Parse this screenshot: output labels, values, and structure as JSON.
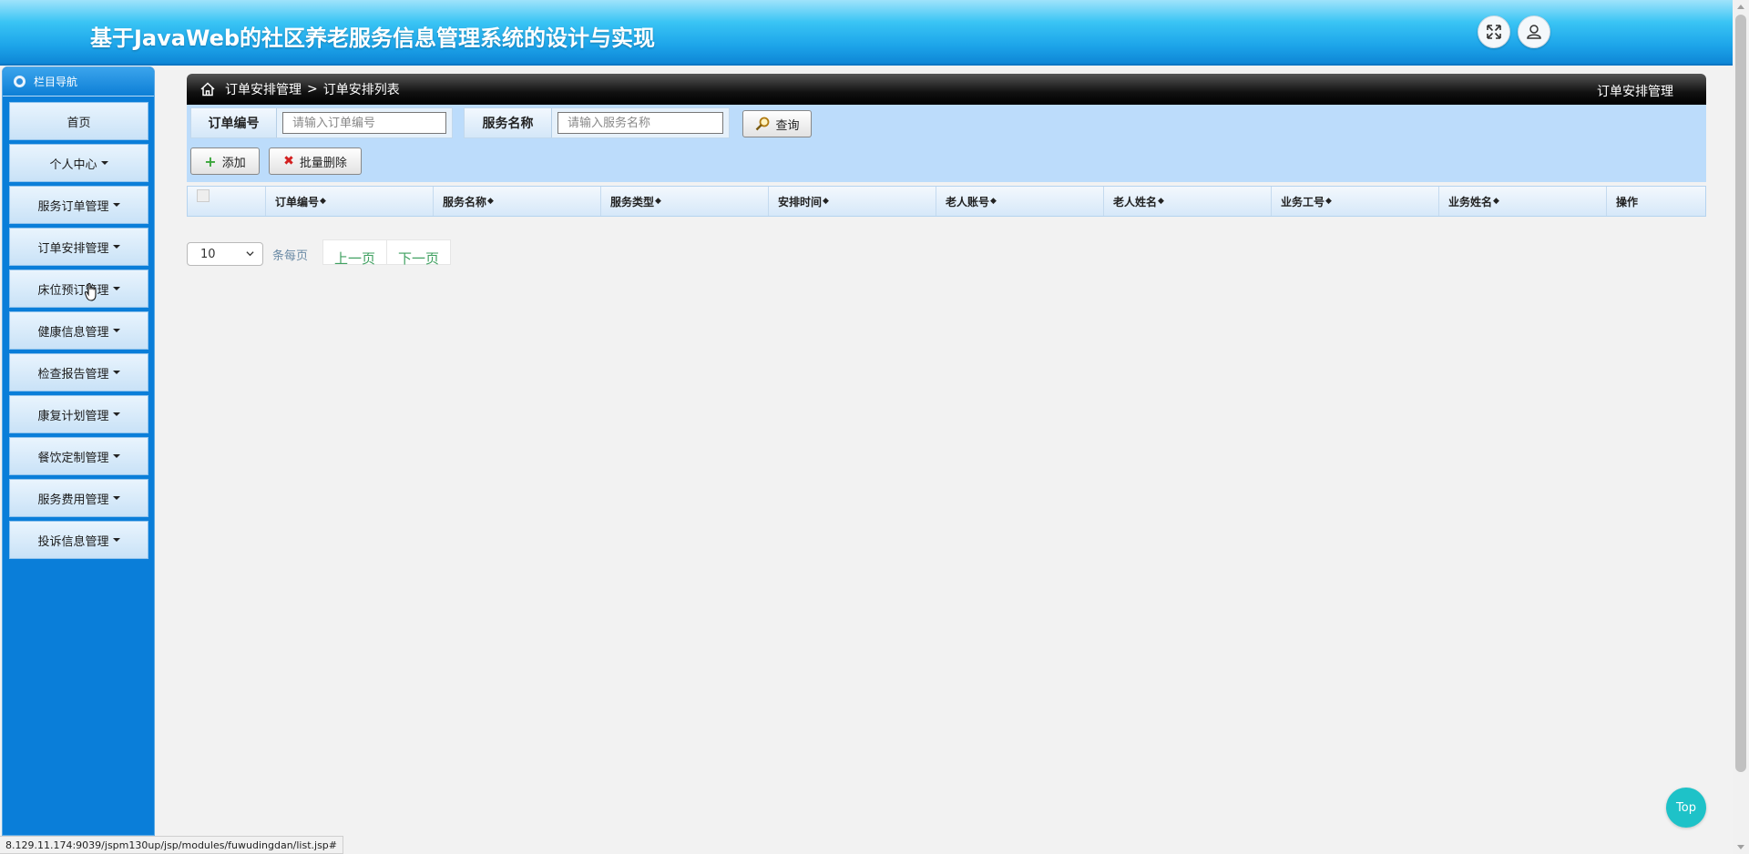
{
  "header": {
    "title": "基于JavaWeb的社区养老服务信息管理系统的设计与实现",
    "fullscreen_icon": "expand-icon",
    "user_icon": "user-icon"
  },
  "sidebar": {
    "heading": "栏目导航",
    "items": [
      {
        "label": "首页",
        "has_caret": false
      },
      {
        "label": "个人中心",
        "has_caret": true
      },
      {
        "label": "服务订单管理",
        "has_caret": true
      },
      {
        "label": "订单安排管理",
        "has_caret": true
      },
      {
        "label": "床位预订管理",
        "has_caret": true
      },
      {
        "label": "健康信息管理",
        "has_caret": true
      },
      {
        "label": "检查报告管理",
        "has_caret": true
      },
      {
        "label": "康复计划管理",
        "has_caret": true
      },
      {
        "label": "餐饮定制管理",
        "has_caret": true
      },
      {
        "label": "服务费用管理",
        "has_caret": true
      },
      {
        "label": "投诉信息管理",
        "has_caret": true
      }
    ]
  },
  "breadcrumb": {
    "parent": "订单安排管理",
    "separator": ">",
    "current": "订单安排列表",
    "right_title": "订单安排管理"
  },
  "search": {
    "order_no_label": "订单编号",
    "order_no_placeholder": "请输入订单编号",
    "order_no_value": "",
    "service_name_label": "服务名称",
    "service_name_placeholder": "请输入服务名称",
    "service_name_value": "",
    "query_button": "查询",
    "add_button": "添加",
    "batch_delete_button": "批量删除"
  },
  "table": {
    "columns": [
      "订单编号",
      "服务名称",
      "服务类型",
      "安排时间",
      "老人账号",
      "老人姓名",
      "业务工号",
      "业务姓名",
      "操作"
    ],
    "rows": []
  },
  "pagination": {
    "page_size": "10",
    "per_page_label": "条每页",
    "prev": "上一页",
    "next": "下一页"
  },
  "top_button": "Top",
  "status_url": "8.129.11.174:9039/jspm130up/jsp/modules/fuwudingdan/list.jsp#",
  "colors": {
    "sidebar_bg": "#0a7ed9",
    "search_bg": "#bcdcfb",
    "top_button": "#1ec2c8"
  }
}
